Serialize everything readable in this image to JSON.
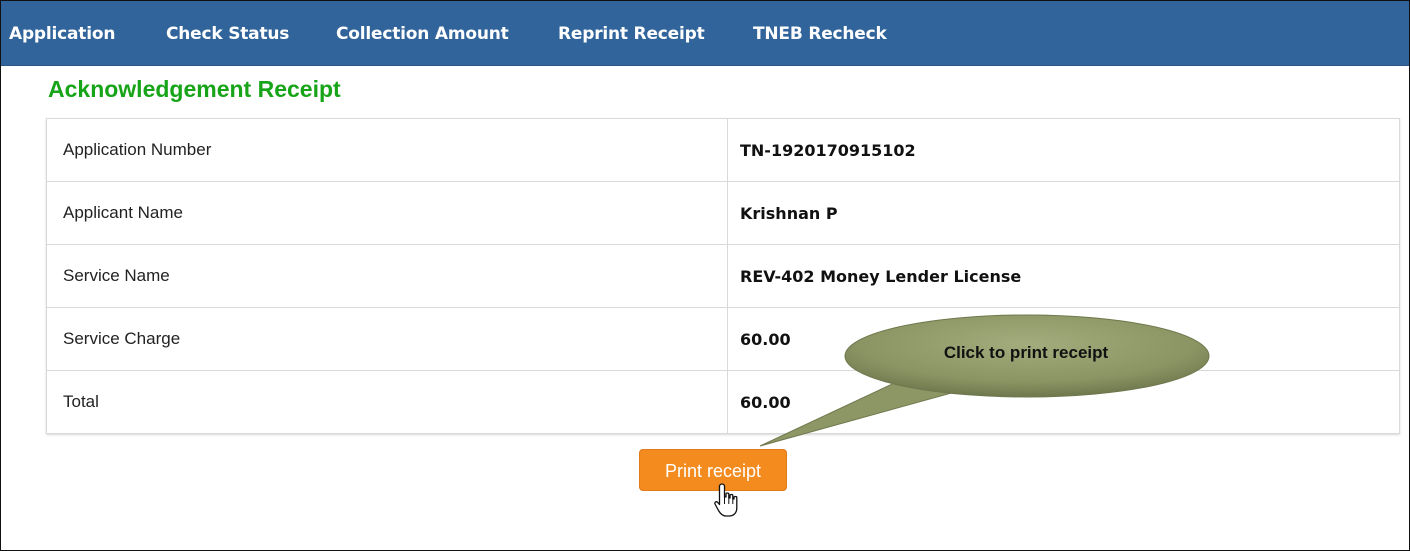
{
  "nav": {
    "items": [
      {
        "label": "Application"
      },
      {
        "label": "Check Status"
      },
      {
        "label": "Collection Amount"
      },
      {
        "label": "Reprint Receipt"
      },
      {
        "label": "TNEB Recheck"
      }
    ]
  },
  "page": {
    "title": "Acknowledgement Receipt"
  },
  "receipt": {
    "rows": [
      {
        "label": "Application Number",
        "value": "TN-1920170915102"
      },
      {
        "label": "Applicant Name",
        "value": "Krishnan P"
      },
      {
        "label": "Service Name",
        "value": "REV-402 Money Lender License"
      },
      {
        "label": "Service Charge",
        "value": "60.00"
      },
      {
        "label": "Total",
        "value": "60.00"
      }
    ]
  },
  "actions": {
    "print_label": "Print receipt"
  },
  "callout": {
    "text": "Click to print receipt",
    "color": "#8a9463"
  },
  "colors": {
    "navbar": "#31649a",
    "title": "#18a419",
    "button": "#f38b1f"
  },
  "icons": {
    "cursor": "hand-pointer-icon"
  }
}
